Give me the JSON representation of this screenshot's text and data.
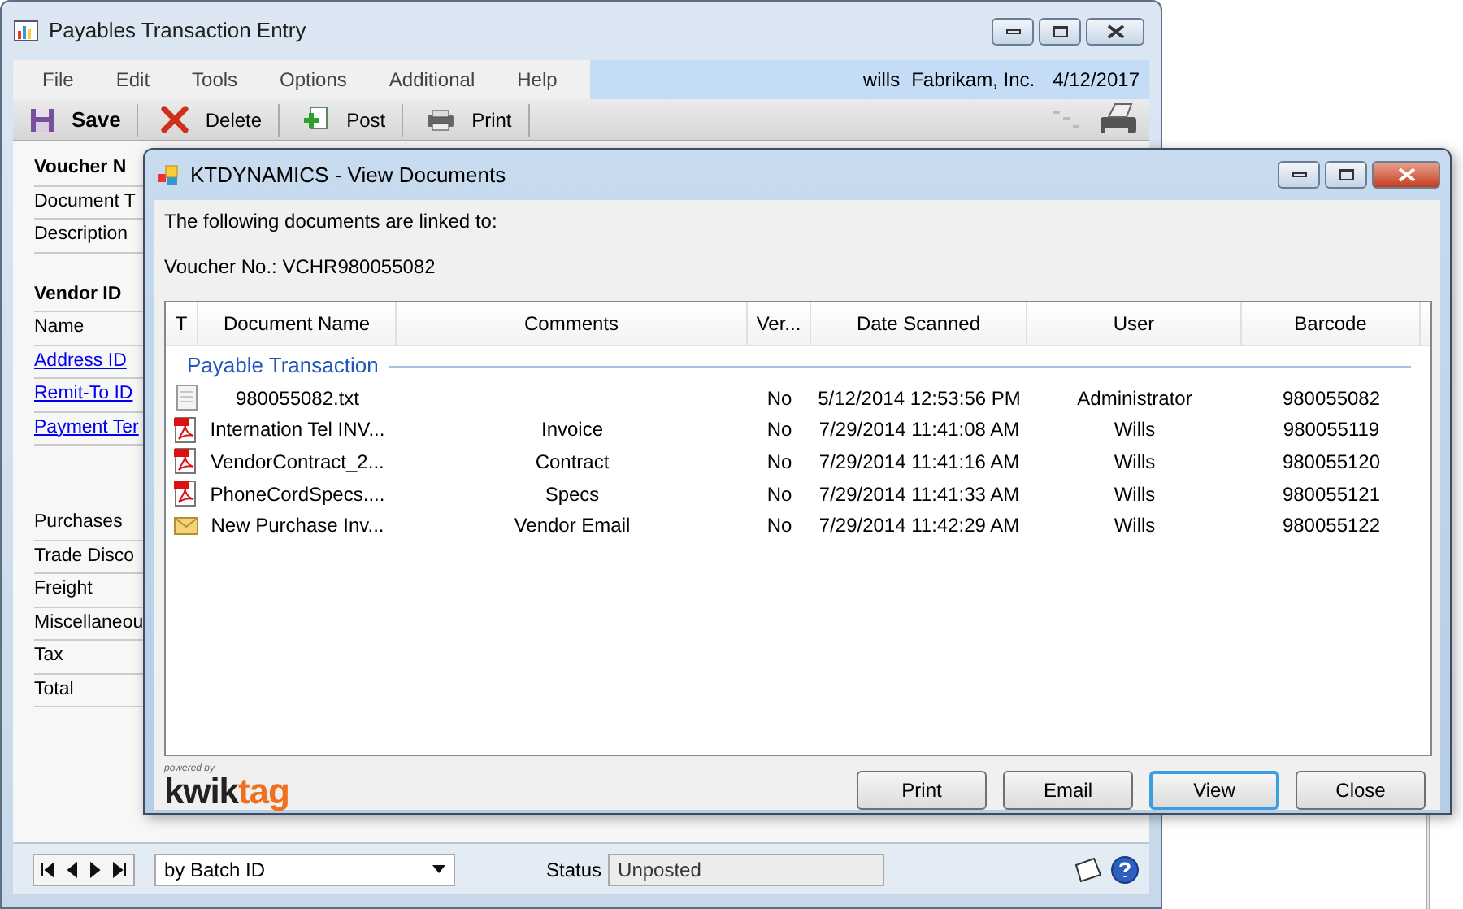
{
  "back_window": {
    "title": "Payables Transaction Entry",
    "menu": [
      "File",
      "Edit",
      "Tools",
      "Options",
      "Additional",
      "Help"
    ],
    "user_info": {
      "user": "wills",
      "company": "Fabrikam, Inc.",
      "date": "4/12/2017"
    },
    "toolbar": [
      {
        "kind": "save",
        "label": "Save"
      },
      {
        "kind": "delete",
        "label": "Delete"
      },
      {
        "kind": "post",
        "label": "Post"
      },
      {
        "kind": "print",
        "label": "Print"
      }
    ],
    "field_groups": [
      [
        {
          "kind": "bold",
          "label": "Voucher N"
        },
        {
          "kind": "plain",
          "label": "Document T"
        },
        {
          "kind": "plain",
          "label": "Description"
        }
      ],
      [
        {
          "kind": "bold",
          "label": "Vendor ID"
        },
        {
          "kind": "plain",
          "label": "Name"
        },
        {
          "kind": "link",
          "label": "Address ID"
        },
        {
          "kind": "link",
          "label": "Remit-To ID"
        },
        {
          "kind": "link",
          "label": "Payment Ter"
        }
      ],
      [
        {
          "kind": "plain",
          "label": "Purchases"
        },
        {
          "kind": "plain",
          "label": "Trade Disco"
        },
        {
          "kind": "plain",
          "label": "Freight"
        },
        {
          "kind": "plain",
          "label": "Miscellaneou"
        },
        {
          "kind": "plain",
          "label": "Tax"
        },
        {
          "kind": "plain",
          "label": "Total"
        }
      ]
    ],
    "sort_dropdown": {
      "value": "by Batch ID"
    },
    "status": {
      "label": "Status",
      "value": "Unposted"
    }
  },
  "dialog": {
    "title": "KTDYNAMICS - View Documents",
    "intro": "The following documents are linked to:",
    "voucher": "Voucher No.: VCHR980055082",
    "columns": [
      "T",
      "Document Name",
      "Comments",
      "Ver...",
      "Date Scanned",
      "User",
      "Barcode"
    ],
    "group": "Payable Transaction",
    "rows": [
      {
        "kind": "text",
        "name": "980055082.txt",
        "comments": "",
        "version": "No",
        "date": "5/12/2014 12:53:56 PM",
        "user": "Administrator",
        "barcode": "980055082"
      },
      {
        "kind": "pdf",
        "name": "Internation Tel INV...",
        "comments": "Invoice",
        "version": "No",
        "date": "7/29/2014 11:41:08 AM",
        "user": "Wills",
        "barcode": "980055119"
      },
      {
        "kind": "pdf",
        "name": "VendorContract_2...",
        "comments": "Contract",
        "version": "No",
        "date": "7/29/2014 11:41:16 AM",
        "user": "Wills",
        "barcode": "980055120"
      },
      {
        "kind": "pdf",
        "name": "PhoneCordSpecs....",
        "comments": "Specs",
        "version": "No",
        "date": "7/29/2014 11:41:33 AM",
        "user": "Wills",
        "barcode": "980055121"
      },
      {
        "kind": "email",
        "name": "New Purchase Inv...",
        "comments": "Vendor Email",
        "version": "No",
        "date": "7/29/2014 11:42:29 AM",
        "user": "Wills",
        "barcode": "980055122"
      }
    ],
    "logo": {
      "caption": "powered by",
      "word_1": "kwik",
      "word_2": "tag"
    },
    "buttons": [
      {
        "label": "Print",
        "focused": false
      },
      {
        "label": "Email",
        "focused": false
      },
      {
        "label": "View",
        "focused": true
      },
      {
        "label": "Close",
        "focused": false
      }
    ]
  }
}
